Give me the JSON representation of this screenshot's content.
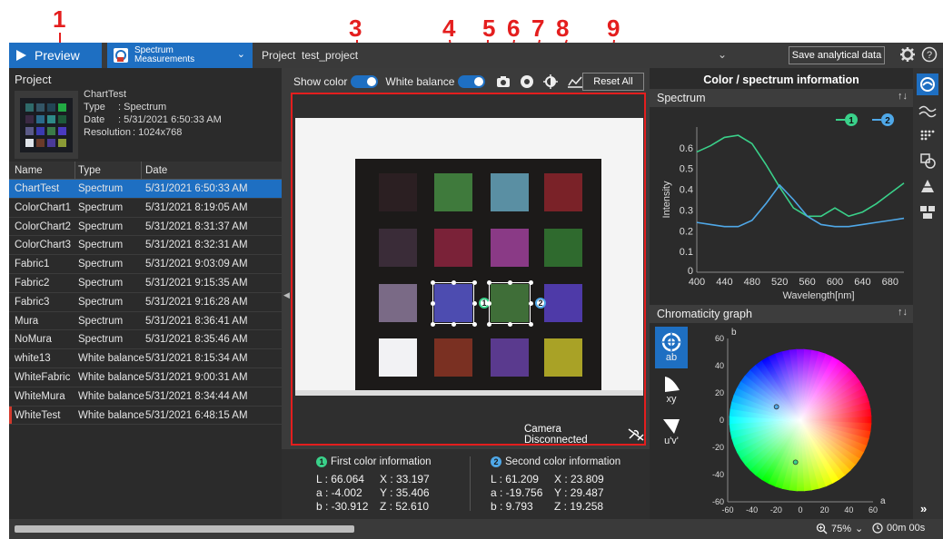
{
  "callouts": [
    "1",
    "2",
    "3",
    "4",
    "5",
    "6",
    "7",
    "8",
    "9"
  ],
  "topbar": {
    "preview_label": "Preview",
    "mode_label_1": "Spectrum",
    "mode_label_2": "Measurements",
    "project_label": "Project",
    "project_name": "test_project",
    "save_label": "Save analytical data"
  },
  "left": {
    "title": "Project",
    "meta": {
      "name": "ChartTest",
      "type_key": "Type",
      "type_val": ": Spectrum",
      "date_key": "Date",
      "date_val": ": 5/31/2021 6:50:33 AM",
      "res_key": "Resolution",
      "res_val": ": 1024x768"
    },
    "columns": [
      "Name",
      "Type",
      "Date"
    ],
    "rows": [
      {
        "name": "ChartTest",
        "type": "Spectrum",
        "date": "5/31/2021 6:50:33 AM"
      },
      {
        "name": "ColorChart1",
        "type": "Spectrum",
        "date": "5/31/2021 8:19:05 AM"
      },
      {
        "name": "ColorChart2",
        "type": "Spectrum",
        "date": "5/31/2021 8:31:37 AM"
      },
      {
        "name": "ColorChart3",
        "type": "Spectrum",
        "date": "5/31/2021 8:32:31 AM"
      },
      {
        "name": "Fabric1",
        "type": "Spectrum",
        "date": "5/31/2021 9:03:09 AM"
      },
      {
        "name": "Fabric2",
        "type": "Spectrum",
        "date": "5/31/2021 9:15:35 AM"
      },
      {
        "name": "Fabric3",
        "type": "Spectrum",
        "date": "5/31/2021 9:16:28 AM"
      },
      {
        "name": "Mura",
        "type": "Spectrum",
        "date": "5/31/2021 8:36:41 AM"
      },
      {
        "name": "NoMura",
        "type": "Spectrum",
        "date": "5/31/2021 8:35:46 AM"
      },
      {
        "name": "white13",
        "type": "White balance",
        "date": "5/31/2021 8:15:34 AM"
      },
      {
        "name": "WhiteFabric",
        "type": "White balance",
        "date": "5/31/2021 9:00:31 AM"
      },
      {
        "name": "WhiteMura",
        "type": "White balance",
        "date": "5/31/2021 8:34:44 AM"
      },
      {
        "name": "WhiteTest",
        "type": "White balance",
        "date": "5/31/2021 6:48:15 AM"
      }
    ]
  },
  "center": {
    "show_color_label": "Show color",
    "white_balance_label": "White balance",
    "reset_label": "Reset All",
    "camera_status": "Camera Disconnected",
    "patch_colors": [
      "#2b1f22",
      "#3f7a3c",
      "#5a8fa3",
      "#7a2228",
      "#3a2c38",
      "#7a2238",
      "#8a3a86",
      "#2f6a2e",
      "#7a6a86",
      "#4d4cb0",
      "#3f6e38",
      "#4e3aa8",
      "#f2f2f4",
      "#7a3022",
      "#5a3a8e",
      "#a9a226"
    ],
    "first": {
      "title": "First color information",
      "L": "L : 66.064",
      "X": "X : 33.197",
      "a": "a : -4.002",
      "Y": "Y : 35.406",
      "b": "b : -30.912",
      "Z": "Z : 52.610"
    },
    "second": {
      "title": "Second color information",
      "L": "L : 61.209",
      "X": "X : 23.809",
      "a": "a : -19.756",
      "Y": "Y : 29.487",
      "b": "b : 9.793",
      "Z": "Z : 19.258"
    }
  },
  "right": {
    "title": "Color / spectrum information",
    "spectrum_head": "Spectrum",
    "chroma_head": "Chromaticity graph",
    "tools": [
      "ab",
      "xy",
      "u'v'"
    ]
  },
  "colors": {
    "accent": "#1e6fc2",
    "callout": "#e41e1e",
    "series1": "#3ad18a",
    "series2": "#4fa8e8"
  },
  "chart_data": [
    {
      "type": "line",
      "title": "Spectrum",
      "xlabel": "Wavelength[nm]",
      "ylabel": "Intensity",
      "xlim": [
        400,
        700
      ],
      "ylim": [
        0,
        0.7
      ],
      "xticks": [
        400,
        440,
        480,
        520,
        560,
        600,
        640,
        680
      ],
      "yticks": [
        0.1,
        0.2,
        0.3,
        0.4,
        0.5,
        0.6
      ],
      "series": [
        {
          "name": "1",
          "x": [
            400,
            420,
            440,
            460,
            480,
            500,
            520,
            540,
            560,
            580,
            600,
            620,
            640,
            660,
            680,
            700
          ],
          "values": [
            0.58,
            0.61,
            0.65,
            0.66,
            0.62,
            0.52,
            0.41,
            0.31,
            0.27,
            0.27,
            0.31,
            0.27,
            0.29,
            0.33,
            0.38,
            0.43
          ]
        },
        {
          "name": "2",
          "x": [
            400,
            420,
            440,
            460,
            480,
            500,
            520,
            540,
            560,
            580,
            600,
            620,
            640,
            660,
            680,
            700
          ],
          "values": [
            0.24,
            0.23,
            0.22,
            0.22,
            0.25,
            0.33,
            0.42,
            0.35,
            0.27,
            0.23,
            0.22,
            0.22,
            0.23,
            0.24,
            0.25,
            0.26
          ]
        }
      ]
    },
    {
      "type": "scatter",
      "title": "Chromaticity graph",
      "xlabel": "a",
      "ylabel": "b",
      "xlim": [
        -60,
        60
      ],
      "ylim": [
        -60,
        60
      ],
      "xticks": [
        -60,
        -40,
        -20,
        0,
        20,
        40,
        60
      ],
      "yticks": [
        -60,
        -40,
        -20,
        0,
        20,
        40,
        60
      ],
      "series": [
        {
          "name": "1",
          "x": [
            -4.002
          ],
          "values": [
            -30.912
          ]
        },
        {
          "name": "2",
          "x": [
            -19.756
          ],
          "values": [
            9.793
          ]
        }
      ]
    }
  ],
  "status": {
    "zoom": "75%",
    "time": "00m 00s"
  }
}
